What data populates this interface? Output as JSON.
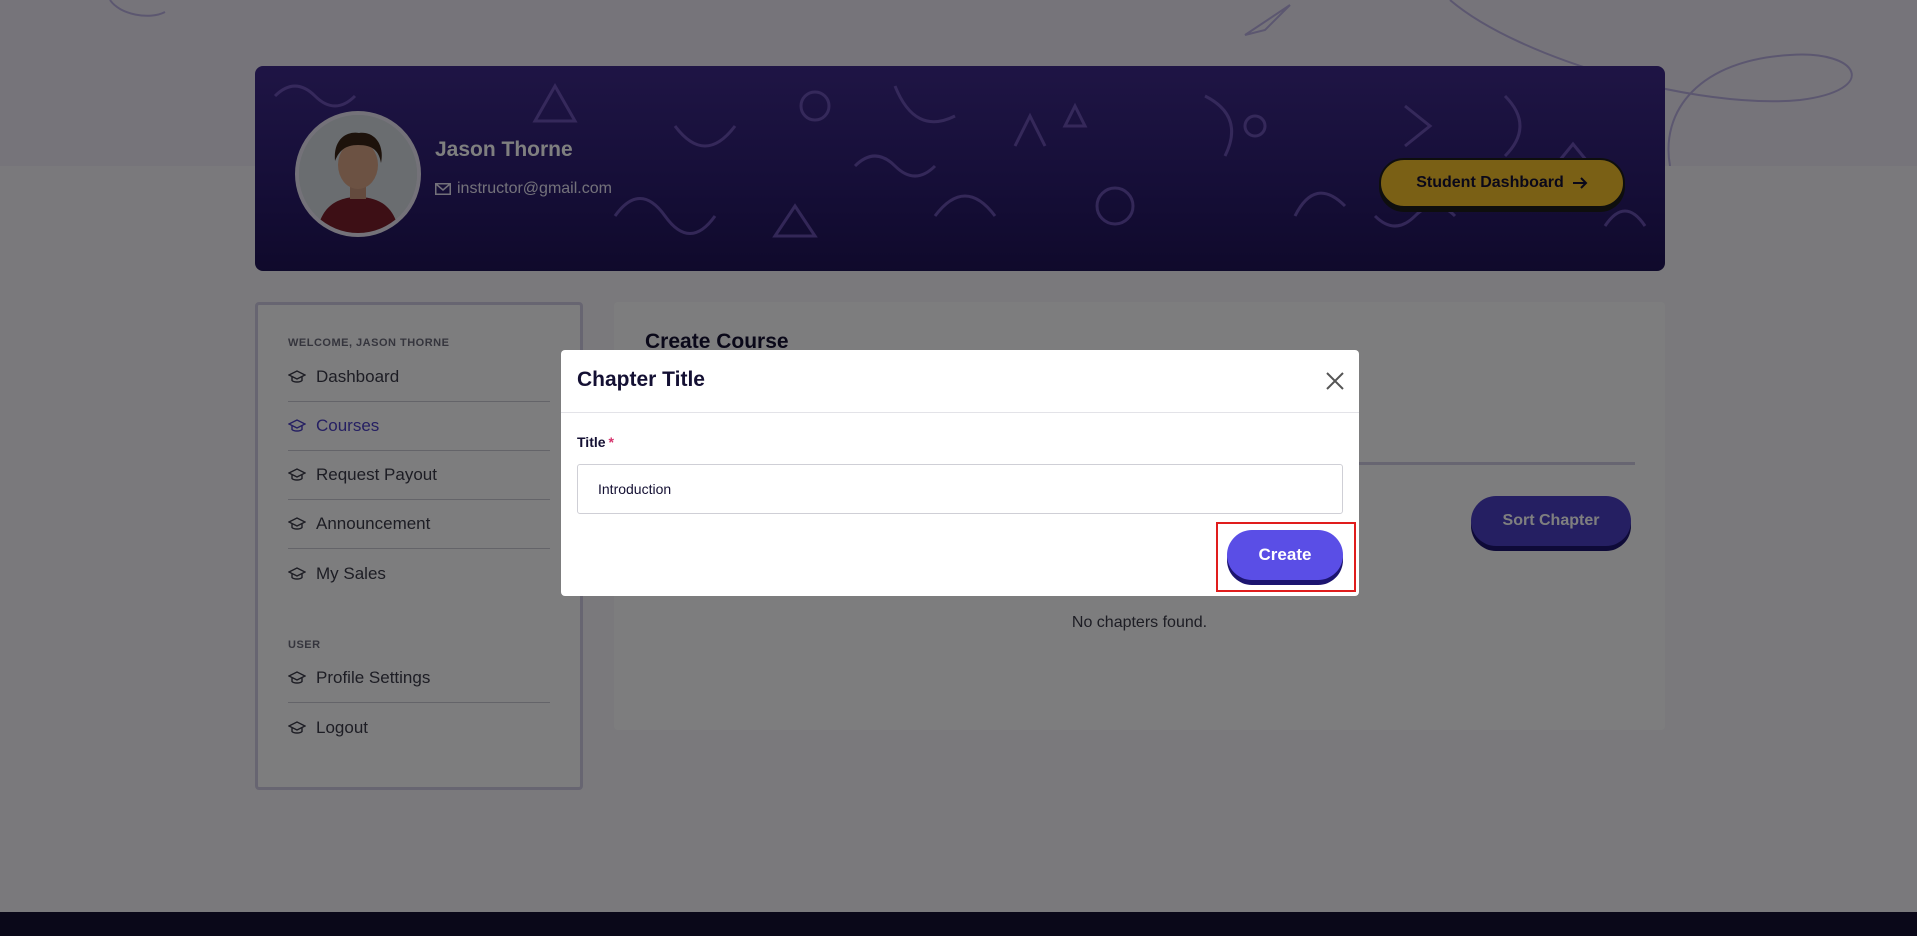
{
  "profile": {
    "name": "Jason Thorne",
    "email": "instructor@gmail.com",
    "student_dashboard_label": "Student Dashboard"
  },
  "sidebar": {
    "welcome_heading": "WELCOME, JASON THORNE",
    "main_items": [
      {
        "label": "Dashboard",
        "active": false
      },
      {
        "label": "Courses",
        "active": true
      },
      {
        "label": "Request Payout",
        "active": false
      },
      {
        "label": "Announcement",
        "active": false
      },
      {
        "label": "My Sales",
        "active": false
      }
    ],
    "user_heading": "USER",
    "user_items": [
      {
        "label": "Profile Settings"
      },
      {
        "label": "Logout"
      }
    ]
  },
  "content": {
    "title": "Create Course",
    "sort_label": "Sort Chapter",
    "empty_message": "No chapters found."
  },
  "modal": {
    "title": "Chapter Title",
    "field_label": "Title",
    "required_mark": "*",
    "field_value": "Introduction",
    "create_label": "Create"
  },
  "colors": {
    "accent": "#5a4ee6",
    "banner": "#2b1c6e",
    "student_button": "#f4c02a",
    "highlight": "#e01d1d"
  }
}
